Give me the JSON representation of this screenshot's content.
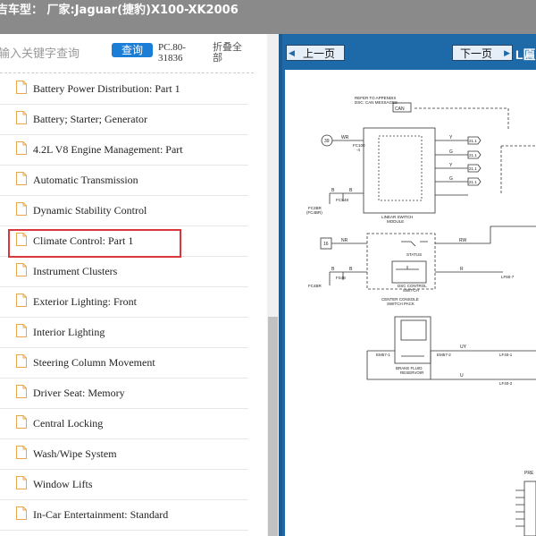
{
  "header": {
    "title": "吉车型： 厂家:Jaguar(捷豹)X100-XK2006"
  },
  "search": {
    "placeholder": "输入关键字查询",
    "button_label": "查询",
    "code": "PC.80-31836",
    "collapse_label": "折叠全部"
  },
  "tree": {
    "items": [
      {
        "label": "Battery Power Distribution: Part 1"
      },
      {
        "label": "Battery; Starter; Generator"
      },
      {
        "label": "4.2L V8 Engine Management: Part"
      },
      {
        "label": "Automatic Transmission"
      },
      {
        "label": "Dynamic Stability Control",
        "selected": true
      },
      {
        "label": "Climate Control: Part 1"
      },
      {
        "label": "Instrument Clusters"
      },
      {
        "label": "Exterior Lighting: Front"
      },
      {
        "label": "Interior Lighting"
      },
      {
        "label": "Steering Column Movement"
      },
      {
        "label": "Driver Seat: Memory"
      },
      {
        "label": "Central Locking"
      },
      {
        "label": "Wash/Wipe System"
      },
      {
        "label": "Window Lifts"
      },
      {
        "label": "In-Car Entertainment: Standard"
      }
    ]
  },
  "viewer": {
    "prev_label": "上一页",
    "next_label": "下一页",
    "next_extra": "L匾"
  },
  "diagram": {
    "refer_note_1": "REFER TO APPENDIX",
    "refer_note_2": "DSC: CAN MESSAGES",
    "can_label": "CAN",
    "c39": "39",
    "wr": "WR",
    "fc100_4": "FC100",
    "fc100_4n": "-4",
    "y1": "Y",
    "g1": "G",
    "y2": "Y",
    "g2": "G",
    "ref_21": "21.1",
    "linear_switch_1": "LINEAR SWITCH",
    "linear_switch_2": "MODULE",
    "b1": "B",
    "b2": "B",
    "fc2br": "FC2BR",
    "fc4br": "(FC4BR)",
    "fcs48": "FCS48",
    "c16": "16",
    "nr": "NR",
    "rw": "RW",
    "status": "STATUS",
    "dsc_control": "DSC CONTROL",
    "switch": "SWITCH",
    "r": "R",
    "center_console_1": "CENTER CONSOLE",
    "center_console_2": "SWITCH PACK",
    "fc4br2": "FC4BR",
    "fs48": "FS48",
    "uy": "UY",
    "u": "U",
    "em57_1": "EM57-1",
    "em57_2": "EM57-2",
    "brake_fluid_1": "BRAKE FLUID",
    "brake_fluid_2": "RESERVOIR",
    "lf40": "LF40-1",
    "lf40b": "LF40-2",
    "lf60": "LF60-7",
    "pre": "PRE"
  }
}
